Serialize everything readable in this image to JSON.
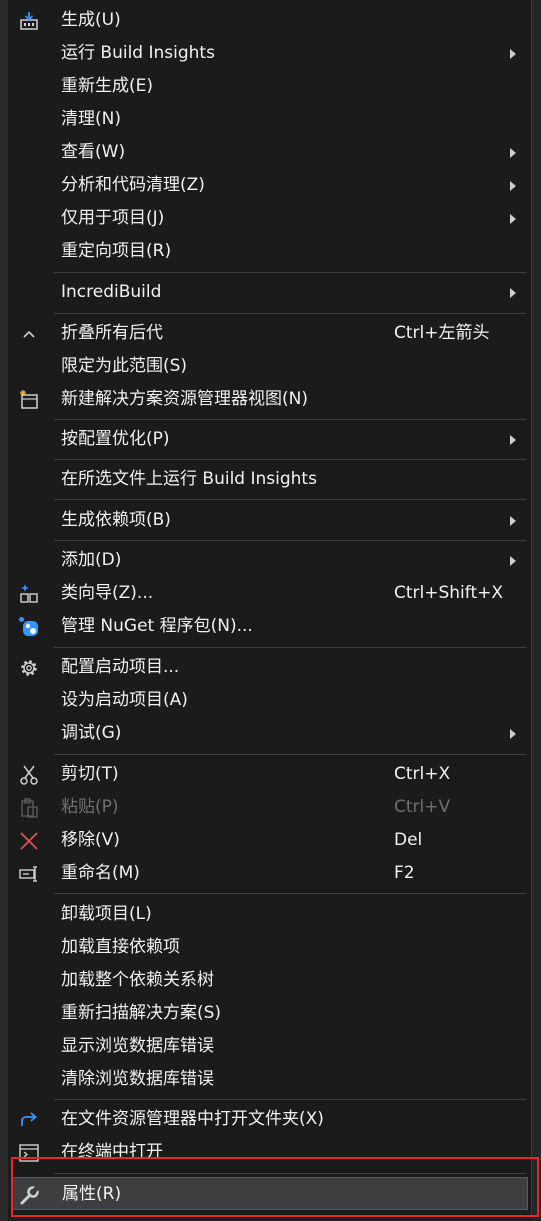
{
  "menu": {
    "items": [
      {
        "label": "生成(U)",
        "shortcut": "",
        "submenu": false,
        "icon": "build-icon"
      },
      {
        "label": "运行 Build Insights",
        "shortcut": "",
        "submenu": true,
        "icon": ""
      },
      {
        "label": "重新生成(E)",
        "shortcut": "",
        "submenu": false,
        "icon": ""
      },
      {
        "label": "清理(N)",
        "shortcut": "",
        "submenu": false,
        "icon": ""
      },
      {
        "label": "查看(W)",
        "shortcut": "",
        "submenu": true,
        "icon": ""
      },
      {
        "label": "分析和代码清理(Z)",
        "shortcut": "",
        "submenu": true,
        "icon": ""
      },
      {
        "label": "仅用于项目(J)",
        "shortcut": "",
        "submenu": true,
        "icon": ""
      },
      {
        "label": "重定向项目(R)",
        "shortcut": "",
        "submenu": false,
        "icon": ""
      },
      {
        "label": "IncrediBuild",
        "shortcut": "",
        "submenu": true,
        "icon": ""
      },
      {
        "label": "折叠所有后代",
        "shortcut": "Ctrl+左箭头",
        "submenu": false,
        "icon": "collapse-icon"
      },
      {
        "label": "限定为此范围(S)",
        "shortcut": "",
        "submenu": false,
        "icon": ""
      },
      {
        "label": "新建解决方案资源管理器视图(N)",
        "shortcut": "",
        "submenu": false,
        "icon": "new-view-icon"
      },
      {
        "label": "按配置优化(P)",
        "shortcut": "",
        "submenu": true,
        "icon": ""
      },
      {
        "label": "在所选文件上运行 Build Insights",
        "shortcut": "",
        "submenu": false,
        "icon": ""
      },
      {
        "label": "生成依赖项(B)",
        "shortcut": "",
        "submenu": true,
        "icon": ""
      },
      {
        "label": "添加(D)",
        "shortcut": "",
        "submenu": true,
        "icon": ""
      },
      {
        "label": "类向导(Z)...",
        "shortcut": "Ctrl+Shift+X",
        "submenu": false,
        "icon": "class-wizard-icon"
      },
      {
        "label": "管理 NuGet 程序包(N)...",
        "shortcut": "",
        "submenu": false,
        "icon": "nuget-icon"
      },
      {
        "label": "配置启动项目...",
        "shortcut": "",
        "submenu": false,
        "icon": "gear-icon"
      },
      {
        "label": "设为启动项目(A)",
        "shortcut": "",
        "submenu": false,
        "icon": ""
      },
      {
        "label": "调试(G)",
        "shortcut": "",
        "submenu": true,
        "icon": ""
      },
      {
        "label": "剪切(T)",
        "shortcut": "Ctrl+X",
        "submenu": false,
        "icon": "scissors-icon"
      },
      {
        "label": "粘贴(P)",
        "shortcut": "Ctrl+V",
        "submenu": false,
        "icon": "paste-icon",
        "disabled": true
      },
      {
        "label": "移除(V)",
        "shortcut": "Del",
        "submenu": false,
        "icon": "remove-icon"
      },
      {
        "label": "重命名(M)",
        "shortcut": "F2",
        "submenu": false,
        "icon": "rename-icon"
      },
      {
        "label": "卸载项目(L)",
        "shortcut": "",
        "submenu": false,
        "icon": ""
      },
      {
        "label": "加载直接依赖项",
        "shortcut": "",
        "submenu": false,
        "icon": ""
      },
      {
        "label": "加载整个依赖关系树",
        "shortcut": "",
        "submenu": false,
        "icon": ""
      },
      {
        "label": "重新扫描解决方案(S)",
        "shortcut": "",
        "submenu": false,
        "icon": ""
      },
      {
        "label": "显示浏览数据库错误",
        "shortcut": "",
        "submenu": false,
        "icon": ""
      },
      {
        "label": "清除浏览数据库错误",
        "shortcut": "",
        "submenu": false,
        "icon": ""
      },
      {
        "label": "在文件资源管理器中打开文件夹(X)",
        "shortcut": "",
        "submenu": false,
        "icon": "open-folder-icon"
      },
      {
        "label": "在终端中打开",
        "shortcut": "",
        "submenu": false,
        "icon": "terminal-icon"
      },
      {
        "label": "属性(R)",
        "shortcut": "",
        "submenu": false,
        "icon": "wrench-icon",
        "selected": true
      }
    ]
  },
  "colors": {
    "background": "#1b1b1c",
    "text": "#f1f1f1",
    "disabled_text": "#6f6f6f",
    "separator": "#3f3f46",
    "selected_background": "#3e3e40",
    "highlight_border": "#e8262c",
    "accent_blue": "#3794ff",
    "remove_red": "#e05252"
  }
}
